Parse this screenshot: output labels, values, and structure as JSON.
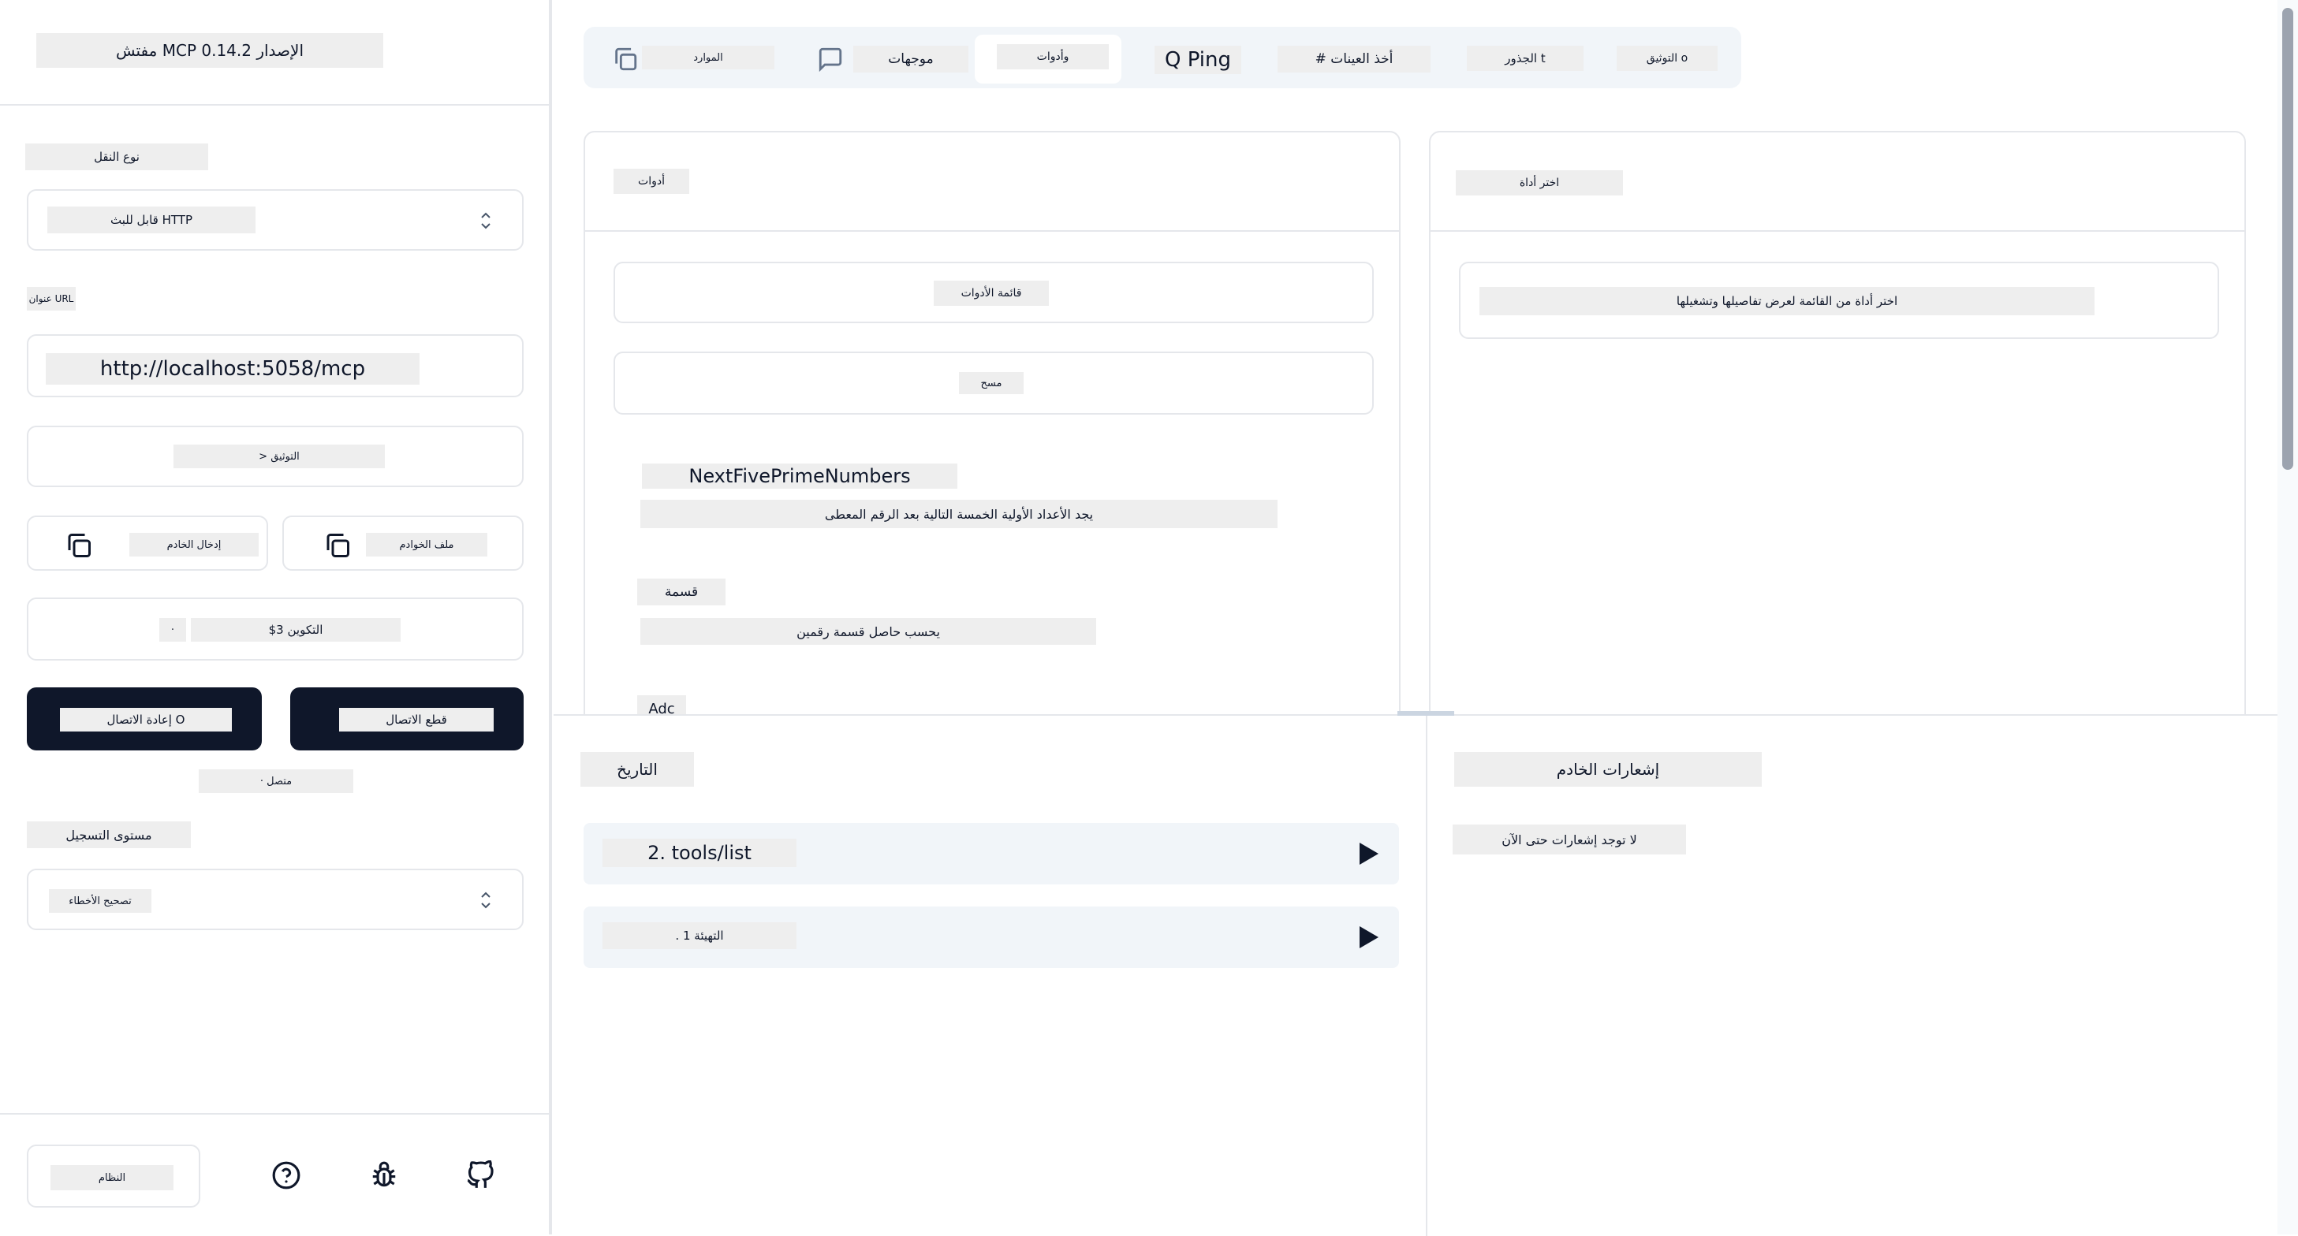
{
  "app": {
    "title": "مفتش MCP الإصدار 0.14.2"
  },
  "sidebar": {
    "transport_label": "نوع النقل",
    "transport_value": "قابل للبث HTTP",
    "url_label": "عنوان URL",
    "url_value": "http://localhost:5058/mcp",
    "auth_button": "> التوثيق",
    "server_entry_button": "إدخال الخادم",
    "server_file_button": "ملف الخوادم",
    "config_button": "$3 التكوين",
    "config_prefix": "·",
    "reconnect_button": "إعادة الاتصال O",
    "disconnect_button": "قطع الاتصال",
    "status": "· متصل",
    "log_level_label": "مستوى التسجيل",
    "log_level_value": "تصحيح الأخطاء",
    "theme_button": "النظام"
  },
  "tabs": [
    {
      "label": "الموارد",
      "icon": "copy-icon"
    },
    {
      "label": "موجهات",
      "icon": "message-square-icon"
    },
    {
      "label": "وأدوات",
      "active": true
    },
    {
      "label": "Q Ping"
    },
    {
      "label": "# أخذ العينات"
    },
    {
      "label": "الجذور t"
    },
    {
      "label": "التوثيق o"
    }
  ],
  "tools_panel": {
    "title": "أدوات",
    "list_button": "قائمة الأدوات",
    "clear_button": "مسح",
    "tools": [
      {
        "name": "NextFivePrimeNumbers",
        "description": "يجد الأعداد الأولية الخمسة التالية بعد الرقم المعطى"
      },
      {
        "name": "قسمة",
        "description": "يحسب حاصل قسمة رقمين"
      },
      {
        "name": "Adc"
      }
    ]
  },
  "detail_panel": {
    "title": "اختر أداة",
    "placeholder": "اختر أداة من القائمة لعرض تفاصيلها وتشغيلها"
  },
  "history": {
    "title": "التاريخ",
    "items": [
      {
        "label": "2. tools/list"
      },
      {
        "label": ". التهيئة 1"
      }
    ]
  },
  "notifications": {
    "title": "إشعارات الخادم",
    "empty": "لا توجد إشعارات حتى الآن"
  },
  "colors": {
    "dark_button": "#0f172a",
    "tab_bg": "#f1f5f9",
    "history_bg": "#f1f5f9",
    "placeholder": "#eeeeee"
  }
}
